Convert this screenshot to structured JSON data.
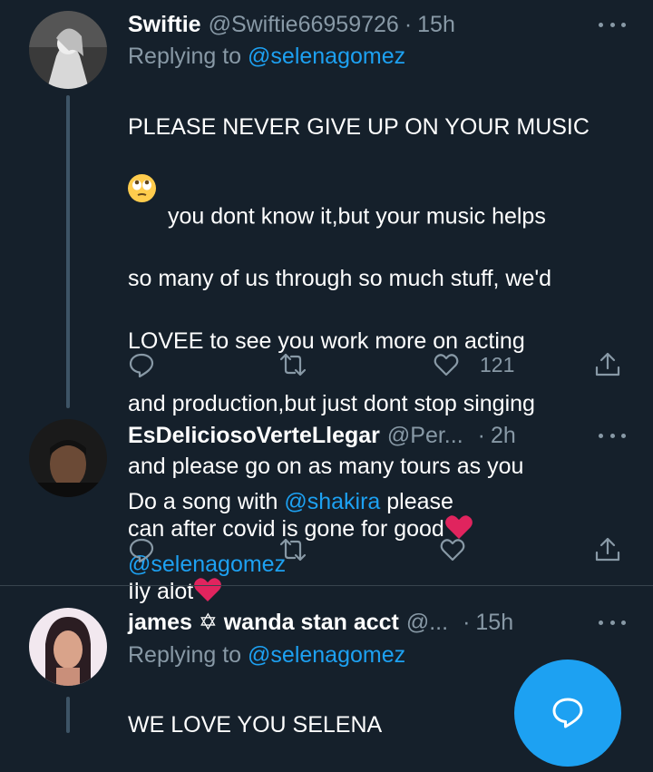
{
  "tweets": [
    {
      "name": "Swiftie",
      "handle": "@Swiftie66959726",
      "time": "15h",
      "replying_prefix": "Replying to ",
      "replying_to": "@selenagomez",
      "line1": "PLEASE NEVER GIVE UP ON YOUR MUSIC",
      "line2": " you dont know it,but your music helps",
      "line3": "so many of us through so much stuff, we'd",
      "line4": "LOVEE to see you work more on acting",
      "line5": "and production,but just dont stop singing",
      "line6": "and please go on as many tours as you",
      "line7": "can after covid is gone for good",
      "line8": "Ily alot",
      "likes": "121"
    },
    {
      "name": "EsDeliciosoVerteLlegar",
      "handle": "@Per...",
      "time": "2h",
      "text_before": "Do a song with ",
      "mention_in_text": "@shakira",
      "text_after": " please",
      "mention_line2": "@selenagomez"
    },
    {
      "name": "james ✡ wanda stan acct",
      "handle": "@...",
      "time": "15h",
      "replying_prefix": "Replying to ",
      "replying_to": "@selenagomez",
      "text": "WE LOVE YOU SELENA"
    }
  ],
  "separator_dot": "·",
  "colors": {
    "background": "#15202b",
    "secondary_text": "#8899a6",
    "link": "#1da1f2",
    "heart": "#e0245e"
  },
  "icons": [
    "reply-icon",
    "retweet-icon",
    "like-icon",
    "share-icon",
    "more-icon",
    "compose-icon"
  ]
}
